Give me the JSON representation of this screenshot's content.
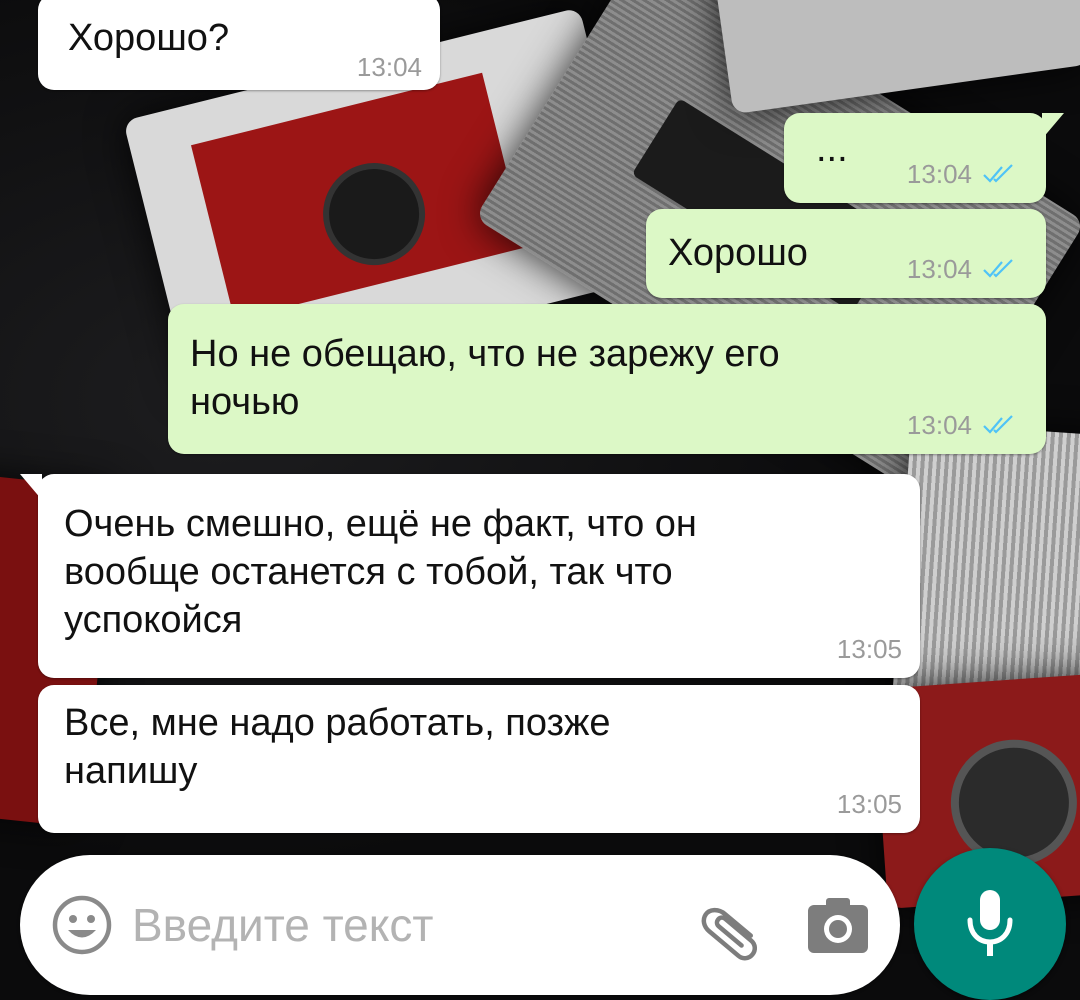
{
  "chat": {
    "messages": [
      {
        "direction": "in",
        "text": "Хорошо?",
        "time": "13:04"
      },
      {
        "direction": "out",
        "text": "...",
        "time": "13:04",
        "status": "read"
      },
      {
        "direction": "out",
        "text": "Хорошо",
        "time": "13:04",
        "status": "read"
      },
      {
        "direction": "out",
        "text": "Но не обещаю, что не зарежу его\nночью",
        "time": "13:04",
        "status": "read"
      },
      {
        "direction": "in",
        "text": "Очень смешно, ещё не факт, что он\nвообще останется с тобой, так что\nуспокойся",
        "time": "13:05"
      },
      {
        "direction": "in",
        "text": "Все, мне надо работать, позже\nнапишу",
        "time": "13:05"
      }
    ]
  },
  "composer": {
    "placeholder": "Введите текст",
    "icons": [
      "emoji-icon",
      "paperclip-icon",
      "camera-icon",
      "microphone-icon"
    ]
  },
  "colors": {
    "incoming_bubble": "#ffffff",
    "outgoing_bubble": "#dcf8c6",
    "read_ticks": "#4fc3f7",
    "timestamp": "#9a9a9a",
    "mic_button": "#00897b",
    "placeholder": "#b3b3b3"
  }
}
